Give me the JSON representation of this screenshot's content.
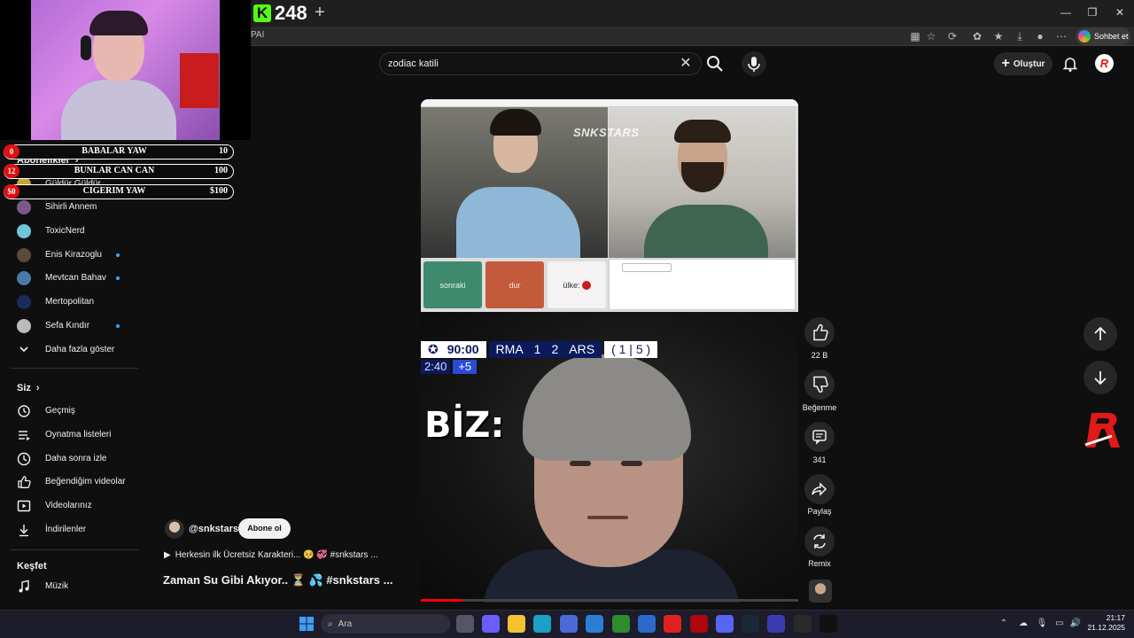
{
  "browser": {
    "tab_title": "248",
    "tab_logo": "K",
    "new_tab": "+",
    "address_fragment": "PAI",
    "copilot_label": "Sohbet et"
  },
  "search": {
    "query": "zodiac katili"
  },
  "header": {
    "create_label": "Oluştur",
    "avatar_letter": "R"
  },
  "scoreboard": [
    {
      "badge": "0",
      "name": "BABALAR YAW",
      "value": "10"
    },
    {
      "badge": "12",
      "name": "BUNLAR CAN CAN",
      "value": "100"
    },
    {
      "badge": "$0",
      "name": "CIGERIM YAW",
      "value": "$100"
    }
  ],
  "sidebar": {
    "subscriptions_title": "Abonelikler",
    "subscriptions": [
      {
        "label": "Güldür Güldür",
        "dot": false,
        "color": "#caa23a"
      },
      {
        "label": "Sihirli Annem",
        "dot": false,
        "color": "#7b5a8a"
      },
      {
        "label": "ToxicNerd",
        "dot": false,
        "color": "#6ec6d6"
      },
      {
        "label": "Enis Kirazoglu",
        "dot": true,
        "color": "#5a4a3a"
      },
      {
        "label": "Mevtcan Bahav",
        "dot": true,
        "color": "#4a7aa8"
      },
      {
        "label": "Mertopolitan",
        "dot": false,
        "color": "#1a2a5a"
      },
      {
        "label": "Sefa Kındır",
        "dot": true,
        "color": "#bbbbbb"
      }
    ],
    "show_more": "Daha fazla göster",
    "you_title": "Siz",
    "you_items": [
      {
        "label": "Geçmiş",
        "icon": "history-icon"
      },
      {
        "label": "Oynatma listeleri",
        "icon": "playlist-icon"
      },
      {
        "label": "Daha sonra izle",
        "icon": "clock-icon"
      },
      {
        "label": "Beğendiğim videolar",
        "icon": "thumb-up-icon"
      },
      {
        "label": "Videolarınız",
        "icon": "video-icon"
      },
      {
        "label": "İndirilenler",
        "icon": "download-icon"
      }
    ],
    "explore_title": "Keşfet",
    "explore_items": [
      {
        "label": "Müzik",
        "icon": "music-icon"
      }
    ]
  },
  "short": {
    "watermark": "SNKSTARS",
    "omegle_buttons": [
      "sonraki",
      "dur",
      "ülke:"
    ],
    "score_time": "90:00",
    "home_team": "RMA",
    "home_score": "1",
    "away_score": "2",
    "away_team": "ARS",
    "penalties": "( 1 | 5 )",
    "clock": "2:40",
    "added_time": "+5",
    "overlay_text": "BİZ:",
    "channel": "@snkstars",
    "subscribe_label": "Abone ol",
    "audio_text": "Herkesin ilk Ücretsiz Karakteri... 🥺 💞 #snkstars ...",
    "title": "Zaman Su Gibi Akıyor.. ⏳ 💦 #snkstars ...",
    "progress": 0.11
  },
  "actions": {
    "likes": "22 B",
    "dislike_label": "Beğenme",
    "comments": "341",
    "share_label": "Paylaş",
    "remix_label": "Remix"
  },
  "taskbar": {
    "search_placeholder": "Ara",
    "time": "21:17",
    "date": "21.12.2025"
  }
}
